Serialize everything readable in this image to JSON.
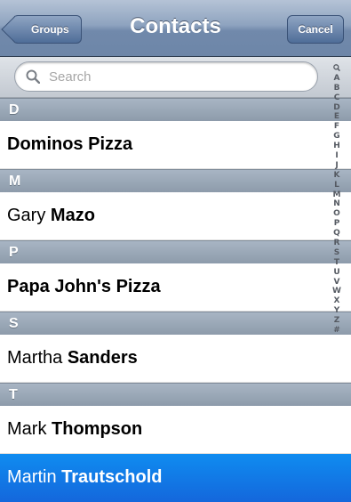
{
  "navbar": {
    "title": "Contacts",
    "back_label": "Groups",
    "cancel_label": "Cancel"
  },
  "search": {
    "placeholder": "Search"
  },
  "sections": [
    {
      "letter": "D",
      "contacts": [
        {
          "first": "",
          "last": "Dominos Pizza"
        }
      ]
    },
    {
      "letter": "M",
      "contacts": [
        {
          "first": "Gary",
          "last": "Mazo"
        }
      ]
    },
    {
      "letter": "P",
      "contacts": [
        {
          "first": "",
          "last": "Papa John's Pizza"
        }
      ]
    },
    {
      "letter": "S",
      "contacts": [
        {
          "first": "Martha",
          "last": "Sanders"
        }
      ]
    },
    {
      "letter": "T",
      "contacts": [
        {
          "first": "Mark",
          "last": "Thompson"
        },
        {
          "first": "Martin",
          "last": "Trautschold",
          "selected": true
        }
      ]
    }
  ],
  "index_letters": [
    "A",
    "B",
    "C",
    "D",
    "E",
    "F",
    "G",
    "H",
    "I",
    "J",
    "K",
    "L",
    "M",
    "N",
    "O",
    "P",
    "Q",
    "R",
    "S",
    "T",
    "U",
    "V",
    "W",
    "X",
    "Y",
    "Z",
    "#"
  ],
  "colors": {
    "navbar": "#7189ab",
    "selected_row": "#1467dc",
    "section_header": "#98a6b6"
  }
}
